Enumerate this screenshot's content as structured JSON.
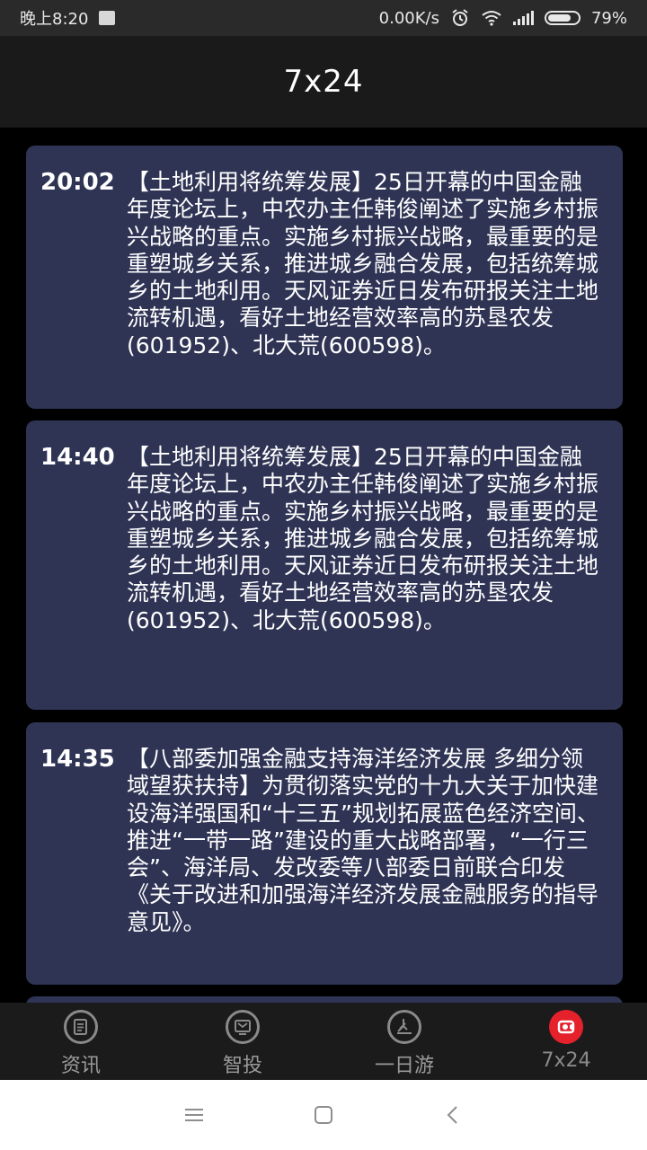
{
  "status": {
    "time": "晚上8:20",
    "speed": "0.00K/s",
    "battery": "79%",
    "battery_level": 0.79
  },
  "header": {
    "title": "7x24"
  },
  "feed": [
    {
      "time": "20:02",
      "text": "【土地利用将统筹发展】25日开幕的中国金融年度论坛上，中农办主任韩俊阐述了实施乡村振兴战略的重点。实施乡村振兴战略，最重要的是重塑城乡关系，推进城乡融合发展，包括统筹城乡的土地利用。天风证券近日发布研报关注土地流转机遇，看好土地经营效率高的苏垦农发(601952)、北大荒(600598)。"
    },
    {
      "time": "14:40",
      "text": "【土地利用将统筹发展】25日开幕的中国金融年度论坛上，中农办主任韩俊阐述了实施乡村振兴战略的重点。实施乡村振兴战略，最重要的是重塑城乡关系，推进城乡融合发展，包括统筹城乡的土地利用。天风证券近日发布研报关注土地流转机遇，看好土地经营效率高的苏垦农发(601952)、北大荒(600598)。"
    },
    {
      "time": "14:35",
      "text": "【八部委加强金融支持海洋经济发展 多细分领域望获扶持】为贯彻落实党的十九大关于加快建设海洋强国和“十三五”规划拓展蓝色经济空间、推进“一带一路”建设的重大战略部署，“一行三会”、海洋局、发改委等八部委日前联合印发《关于改进和加强海洋经济发展金融服务的指导意见》。"
    }
  ],
  "tabs": [
    {
      "label": "资讯",
      "icon": "news-icon",
      "active": false
    },
    {
      "label": "智投",
      "icon": "invest-icon",
      "active": false
    },
    {
      "label": "一日游",
      "icon": "day-trip-icon",
      "active": false
    },
    {
      "label": "7x24",
      "icon": "live-7x24-icon",
      "active": true
    }
  ],
  "colors": {
    "card_bg": "#2f3455",
    "active_tab": "#e5212b"
  }
}
